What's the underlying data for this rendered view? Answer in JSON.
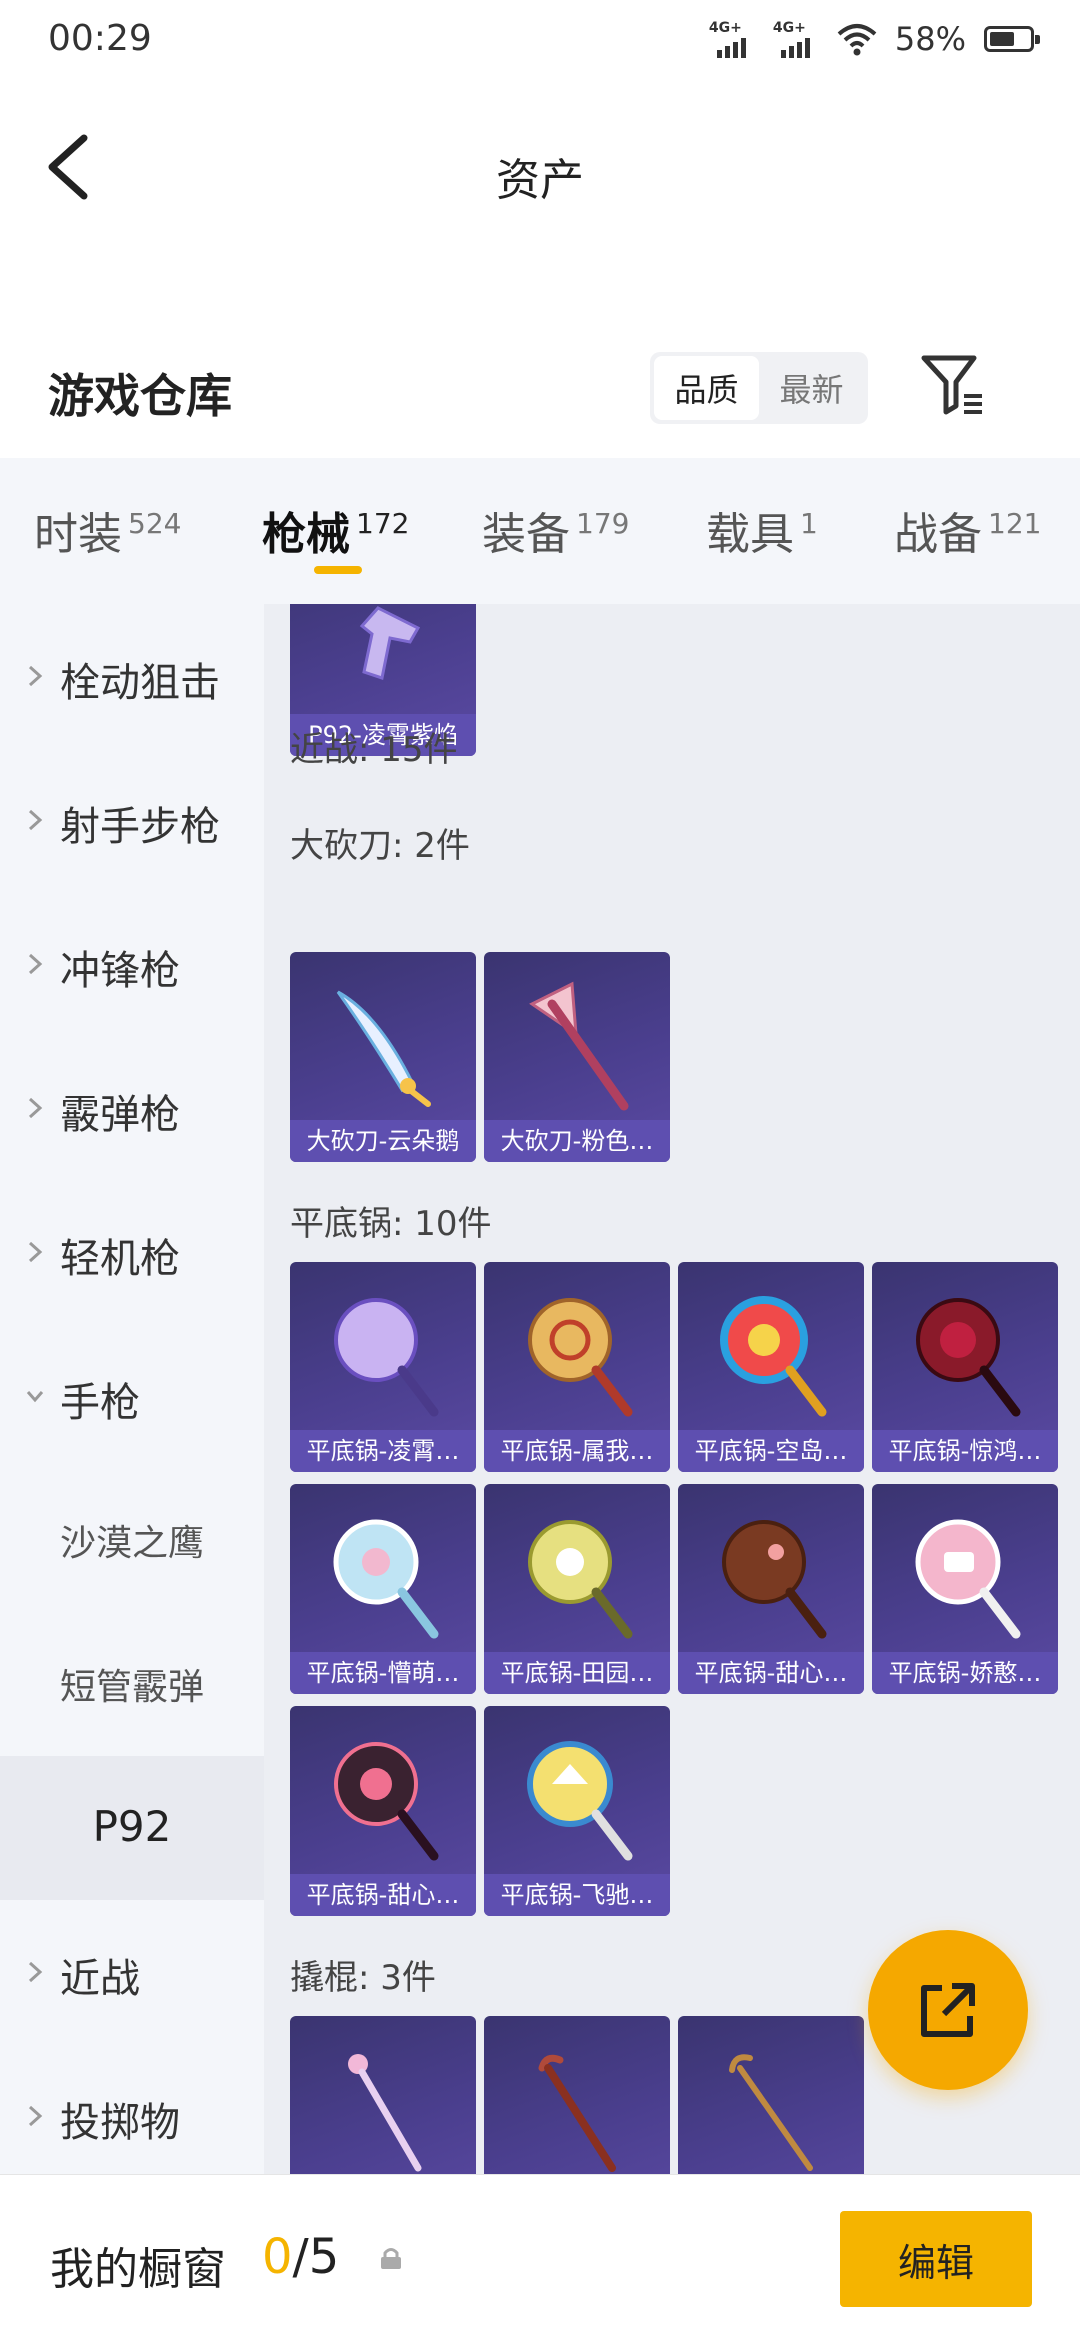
{
  "status_bar": {
    "time": "00:29",
    "net1": "4G+",
    "net2": "4G+",
    "battery": "58%"
  },
  "header": {
    "title": "资产"
  },
  "warehouse": {
    "title": "游戏仓库",
    "sort_quality": "品质",
    "sort_newest": "最新"
  },
  "tabs": [
    {
      "label": "时装",
      "count": "524"
    },
    {
      "label": "枪械",
      "count": "172"
    },
    {
      "label": "装备",
      "count": "179"
    },
    {
      "label": "载具",
      "count": "1"
    },
    {
      "label": "战备",
      "count": "121"
    }
  ],
  "sidebar": [
    "栓动狙击",
    "射手步枪",
    "冲锋枪",
    "霰弹枪",
    "轻机枪",
    "手枪",
    "沙漠之鹰",
    "短管霰弹",
    "P92",
    "近战",
    "投掷物"
  ],
  "content": {
    "top_item": "P92-凌霄紫焰",
    "melee": "近战: 15件",
    "machete_label": "大砍刀: 2件",
    "machetes": [
      "大砍刀-云朵鹅",
      "大砍刀-粉色…"
    ],
    "pan_label": "平底锅: 10件",
    "pans": [
      "平底锅-凌霄…",
      "平底锅-属我…",
      "平底锅-空岛…",
      "平底锅-惊鸿…",
      "平底锅-懵萌…",
      "平底锅-田园…",
      "平底锅-甜心…",
      "平底锅-娇憨…",
      "平底锅-甜心…",
      "平底锅-飞驰…"
    ],
    "crowbar_label": "撬棍: 3件"
  },
  "bottom": {
    "showcase_label": "我的橱窗",
    "current": "0",
    "sep_total": "/5",
    "edit": "编辑"
  },
  "colors": {
    "accent": "#f5b400",
    "card": "#4b3f8f",
    "card_label": "#5e4fb0"
  }
}
